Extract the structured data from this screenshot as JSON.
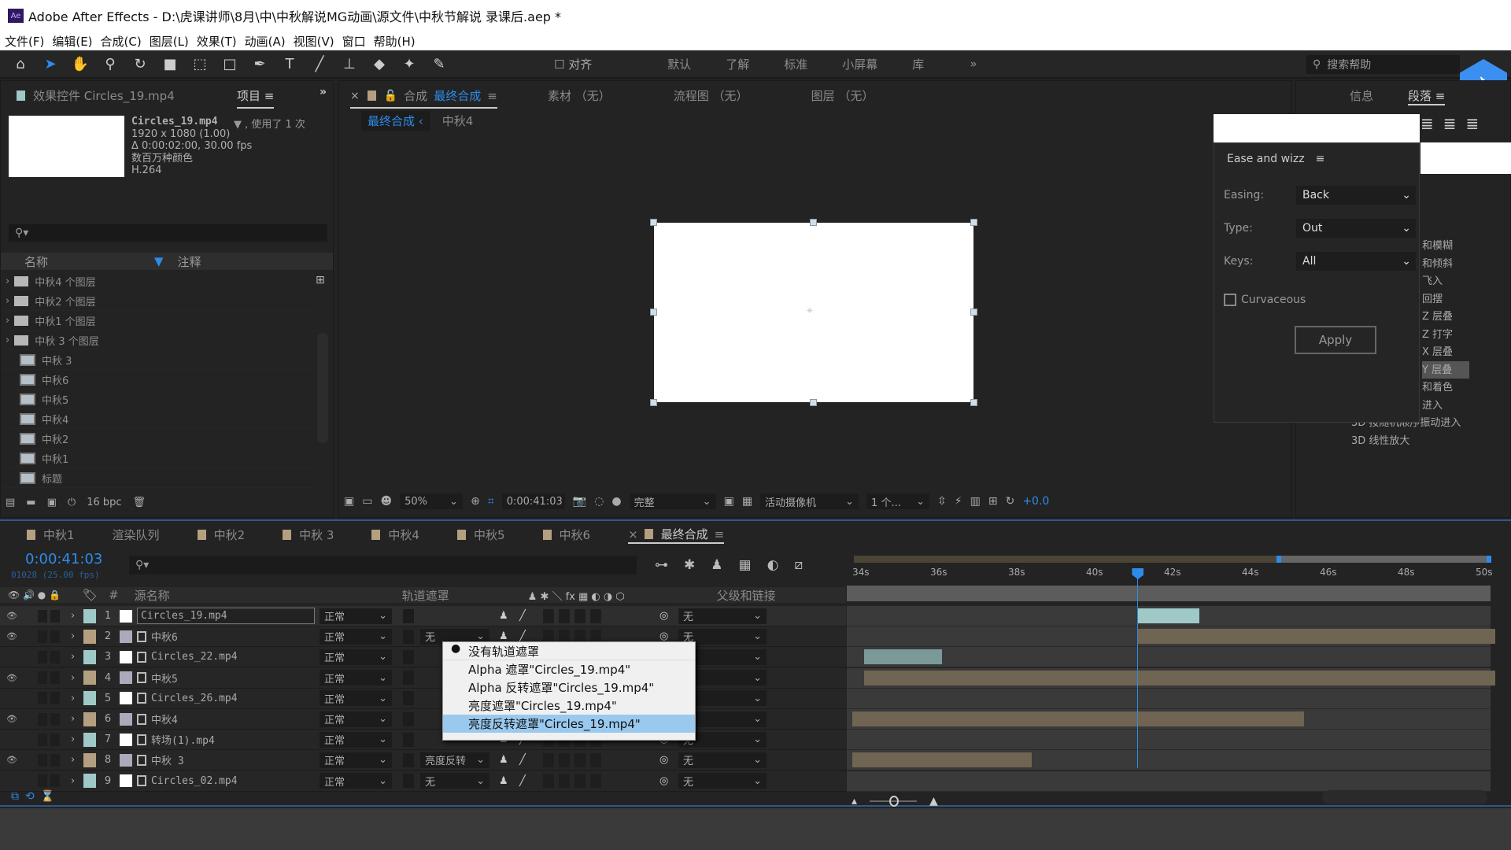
{
  "window": {
    "title": "Adobe After Effects - D:\\虎课讲师\\8月\\中\\中秋解说MG动画\\源文件\\中秋节解说 录课后.aep *",
    "app_badge": "Ae"
  },
  "menu": [
    "文件(F)",
    "编辑(E)",
    "合成(C)",
    "图层(L)",
    "效果(T)",
    "动画(A)",
    "视图(V)",
    "窗口",
    "帮助(H)"
  ],
  "toolbar": {
    "align_label": "对齐",
    "workspaces": [
      "默认",
      "了解",
      "标准",
      "小屏幕",
      "库"
    ],
    "more": "»",
    "search_placeholder": "搜索帮助"
  },
  "project_panel": {
    "effects_tab": "效果控件 Circles_19.mp4",
    "project_tab": "项目",
    "footage": {
      "name": "Circles_19.mp4",
      "used": "▼ , 使用了 1 次",
      "size": "1920 x 1080 (1.00)",
      "duration": "Δ 0:00:02:00, 30.00 fps",
      "colors": "数百万种颜色",
      "codec": "H.264"
    },
    "columns": {
      "name": "名称",
      "comment": "注释"
    },
    "items": [
      {
        "type": "folder",
        "label": "中秋4 个图层"
      },
      {
        "type": "folder",
        "label": "中秋2 个图层"
      },
      {
        "type": "folder",
        "label": "中秋1 个图层"
      },
      {
        "type": "folder",
        "label": "中秋 3 个图层"
      },
      {
        "type": "comp",
        "label": "中秋 3"
      },
      {
        "type": "comp",
        "label": "中秋6"
      },
      {
        "type": "comp",
        "label": "中秋5"
      },
      {
        "type": "comp",
        "label": "中秋4"
      },
      {
        "type": "comp",
        "label": "中秋2"
      },
      {
        "type": "comp",
        "label": "中秋1"
      },
      {
        "type": "comp",
        "label": "标题"
      }
    ],
    "bpc": "16 bpc"
  },
  "comp_panel": {
    "tab_prefix": "合成",
    "tab_name": "最终合成",
    "other_tabs": [
      "素材 （无）",
      "流程图 （无）",
      "图层 （无）"
    ],
    "breadcrumb": [
      "最终合成",
      "中秋4"
    ],
    "zoom": "50%",
    "timecode": "0:00:41:03",
    "quality": "完整",
    "camera": "活动摄像机",
    "views": "1 个...",
    "exposure": "+0.0"
  },
  "right_panel": {
    "tabs": [
      "信息",
      "段落"
    ],
    "effects_list": [
      "和模糊",
      "和倾斜",
      "飞入",
      "回摆",
      "Z 层叠",
      "Z 打字",
      "X 层叠",
      "Y 层叠",
      "和着色",
      "进入",
      "3D 按随机顺序振动进入",
      "3D 线性放大"
    ]
  },
  "ease_panel": {
    "title": "Ease and wizz",
    "easing_label": "Easing:",
    "easing": "Back",
    "type_label": "Type:",
    "type": "Out",
    "keys_label": "Keys:",
    "keys": "All",
    "curvaceous_label": "Curvaceous",
    "curvaceous": false,
    "apply": "Apply"
  },
  "timeline": {
    "tabs": [
      "中秋1",
      "渲染队列",
      "中秋2",
      "中秋 3",
      "中秋4",
      "中秋5",
      "中秋6",
      "最终合成"
    ],
    "active_tab": "最终合成",
    "timecode": "0:00:41:03",
    "frames": "01028 (25.00 fps)",
    "columns": {
      "num": "#",
      "source": "源名称",
      "matte": "轨道遮罩",
      "parent": "父级和链接"
    },
    "ruler": [
      "34s",
      "36s",
      "38s",
      "40s",
      "42s",
      "44s",
      "46s",
      "48s",
      "50s"
    ],
    "playhead_s": 41.12,
    "layers": [
      {
        "n": "1",
        "name": "Circles_19.mp4",
        "mode": "正常",
        "matte": "",
        "parent": "无",
        "color": "#9fc9c6",
        "eye": true,
        "start": 41.12,
        "end": 42.7
      },
      {
        "n": "2",
        "name": "中秋6",
        "mode": "正常",
        "matte": "无",
        "parent": "无",
        "color": "#b49f80",
        "eye": true,
        "start": 41.12,
        "end": 50.3
      },
      {
        "n": "3",
        "name": "Circles_22.mp4",
        "mode": "正常",
        "matte": "",
        "parent": "无",
        "color": "#9fc9c6",
        "eye": false,
        "start": 34.1,
        "end": 36.1
      },
      {
        "n": "4",
        "name": "中秋5",
        "mode": "正常",
        "matte": "",
        "parent": "无",
        "color": "#b49f80",
        "eye": true,
        "start": 34.1,
        "end": 50.3
      },
      {
        "n": "5",
        "name": "Circles_26.mp4",
        "mode": "正常",
        "matte": "",
        "parent": "无",
        "color": "#9fc9c6",
        "eye": false,
        "start": null,
        "end": null
      },
      {
        "n": "6",
        "name": "中秋4",
        "mode": "正常",
        "matte": "",
        "parent": "无",
        "color": "#b49f80",
        "eye": true,
        "start": 33.7,
        "end": 45.4
      },
      {
        "n": "7",
        "name": "转场(1).mp4",
        "mode": "正常",
        "matte": "",
        "parent": "无",
        "color": "#9fc9c6",
        "eye": false,
        "start": null,
        "end": null
      },
      {
        "n": "8",
        "name": "中秋 3",
        "mode": "正常",
        "matte": "亮度反转",
        "parent": "无",
        "color": "#b49f80",
        "eye": true,
        "start": 33.7,
        "end": 38.4
      },
      {
        "n": "9",
        "name": "Circles_02.mp4",
        "mode": "正常",
        "matte": "无",
        "parent": "无",
        "color": "#9fc9c6",
        "eye": false,
        "start": null,
        "end": null
      }
    ],
    "matte_menu": {
      "items": [
        "没有轨道遮罩",
        "Alpha 遮罩\"Circles_19.mp4\"",
        "Alpha 反转遮罩\"Circles_19.mp4\"",
        "亮度遮罩\"Circles_19.mp4\"",
        "亮度反转遮罩\"Circles_19.mp4\""
      ],
      "checked": 0,
      "highlighted": 4
    }
  },
  "colors": {
    "accent": "#2d8ceb",
    "layer_cyan": "#9fc9c6",
    "layer_tan": "#b49f80",
    "bar_tan": "#6f6552"
  }
}
